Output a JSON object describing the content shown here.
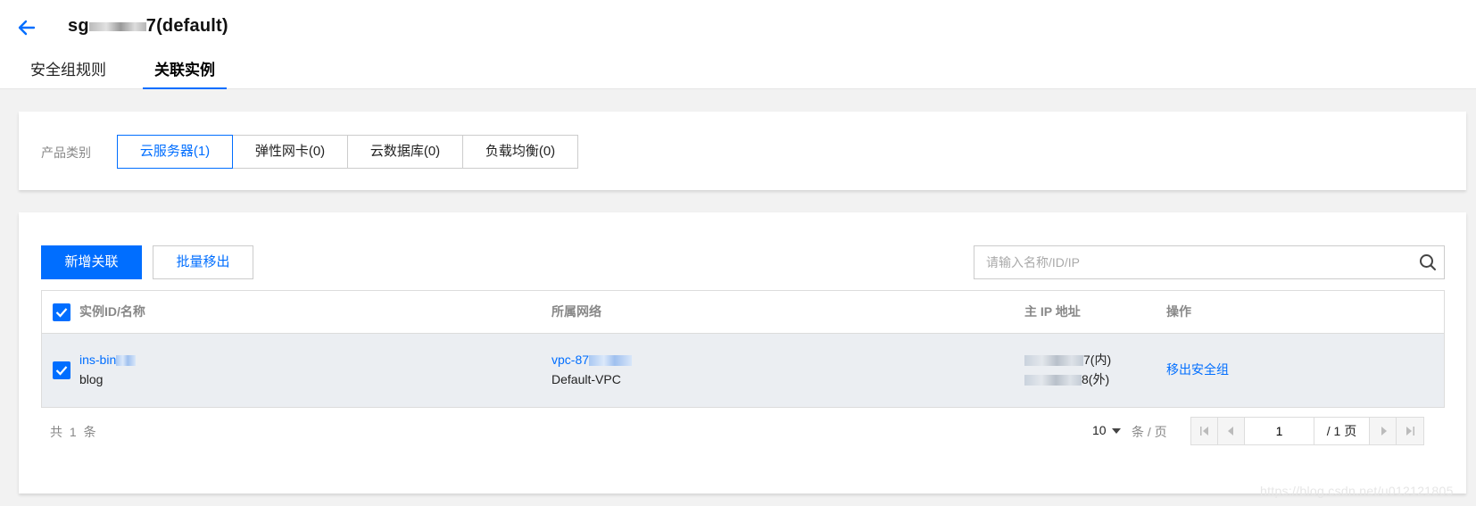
{
  "header": {
    "title_prefix": "sg",
    "title_suffix": "7(default)",
    "tabs": [
      {
        "label": "安全组规则",
        "active": false
      },
      {
        "label": "关联实例",
        "active": true
      }
    ]
  },
  "product_filter": {
    "label": "产品类别",
    "options": [
      {
        "label": "云服务器(1)",
        "active": true
      },
      {
        "label": "弹性网卡(0)",
        "active": false
      },
      {
        "label": "云数据库(0)",
        "active": false
      },
      {
        "label": "负载均衡(0)",
        "active": false
      }
    ]
  },
  "toolbar": {
    "add_label": "新增关联",
    "batch_remove_label": "批量移出",
    "search_placeholder": "请输入名称/ID/IP"
  },
  "table": {
    "columns": [
      "实例ID/名称",
      "所属网络",
      "主 IP 地址",
      "操作"
    ],
    "rows": [
      {
        "instance_id_prefix": "ins-bin",
        "instance_name": "blog",
        "vpc_id_prefix": "vpc-87",
        "vpc_name": "Default-VPC",
        "private_ip_suffix": "7(内)",
        "public_ip_suffix": "8(外)",
        "action": "移出安全组"
      }
    ]
  },
  "pagination": {
    "total_text": "共 1 条",
    "page_size": "10",
    "per_page_label": "条 / 页",
    "current_page": "1",
    "total_pages_label": "/ 1 页"
  },
  "watermark": "https://blog.csdn.net/u012121805",
  "colors": {
    "accent": "#006eff",
    "page_bg": "#f2f2f2",
    "row_selected": "#ebeef2"
  }
}
